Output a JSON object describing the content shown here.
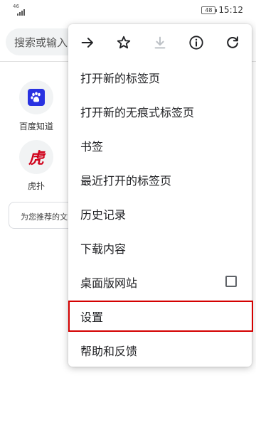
{
  "status_bar": {
    "signal_label": "46",
    "battery": "48",
    "time": "15:12"
  },
  "page": {
    "search_placeholder": "搜索或输入",
    "shortcuts": [
      {
        "label": "百度知道",
        "icon": "baidu-paw-icon"
      },
      {
        "label": "虎扑",
        "icon_text": "虎"
      }
    ],
    "recommend_text": "为您推荐的文"
  },
  "menu": {
    "toolbar": [
      {
        "name": "forward-arrow-icon"
      },
      {
        "name": "bookmark-star-icon"
      },
      {
        "name": "download-icon",
        "disabled": true
      },
      {
        "name": "page-info-icon"
      },
      {
        "name": "reload-icon"
      }
    ],
    "items": [
      {
        "label": "打开新的标签页"
      },
      {
        "label": "打开新的无痕式标签页"
      },
      {
        "label": "书签"
      },
      {
        "label": "最近打开的标签页"
      },
      {
        "label": "历史记录"
      },
      {
        "label": "下载内容"
      },
      {
        "label": "桌面版网站",
        "checkbox": false
      },
      {
        "label": "设置",
        "highlighted": true
      },
      {
        "label": "帮助和反馈"
      }
    ],
    "colors": {
      "icon": "#202124",
      "disabled_icon": "#bdc1c6",
      "highlight_border": "#d40000"
    }
  }
}
